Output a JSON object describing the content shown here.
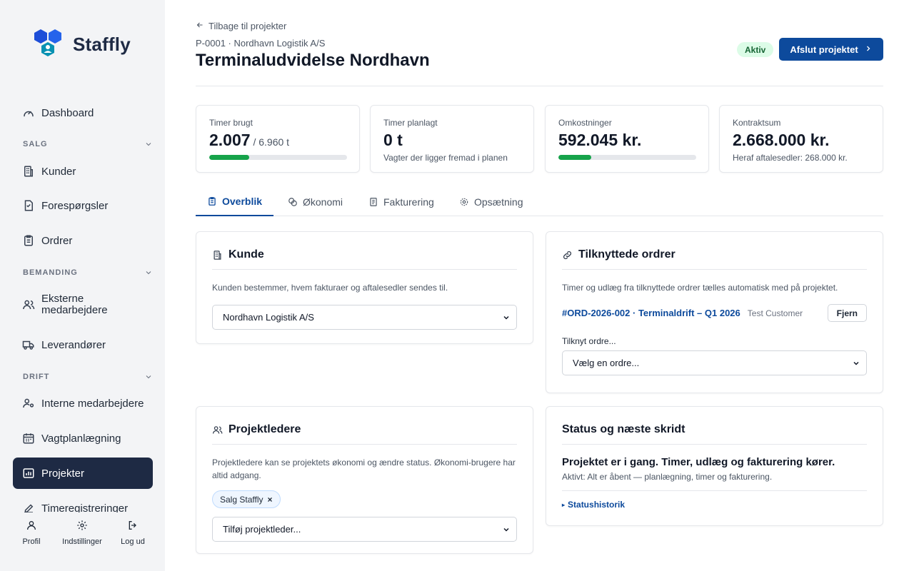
{
  "brand": {
    "name": "Staffly"
  },
  "sidebar": {
    "dashboard": "Dashboard",
    "sections": {
      "salg": "SALG",
      "bemanding": "BEMANDING",
      "drift": "DRIFT"
    },
    "items": {
      "kunder": "Kunder",
      "forespoergsler": "Forespørgsler",
      "ordrer": "Ordrer",
      "eksterne_1": "Eksterne",
      "eksterne_2": "medarbejdere",
      "leverandoerer": "Leverandører",
      "interne": "Interne medarbejdere",
      "vagtplan": "Vagtplanlægning",
      "projekter": "Projekter",
      "timereg": "Timeregistreringer"
    },
    "bottom": {
      "profil": "Profil",
      "indstillinger": "Indstillinger",
      "logud": "Log ud"
    }
  },
  "header": {
    "back": "Tilbage til projekter",
    "subtitle": "P-0001 · Nordhavn Logistik A/S",
    "title": "Terminaludvidelse Nordhavn",
    "status": "Aktiv",
    "primary_action": "Afslut projektet"
  },
  "stats": {
    "timer_brugt": {
      "label": "Timer brugt",
      "value": "2.007",
      "suffix": " / 6.960 t",
      "progress": 0.288
    },
    "timer_planlagt": {
      "label": "Timer planlagt",
      "value": "0 t",
      "sub": "Vagter der ligger fremad i planen"
    },
    "omkostninger": {
      "label": "Omkostninger",
      "value": "592.045 kr.",
      "progress": 0.24
    },
    "kontraktsum": {
      "label": "Kontraktsum",
      "value": "2.668.000 kr.",
      "sub": "Heraf aftalesedler: 268.000 kr."
    }
  },
  "tabs": {
    "overblik": "Overblik",
    "oekonomi": "Økonomi",
    "fakturering": "Fakturering",
    "opsaetning": "Opsætning"
  },
  "kunde": {
    "title": "Kunde",
    "desc": "Kunden bestemmer, hvem fakturaer og aftalesedler sendes til.",
    "selected": "Nordhavn Logistik A/S"
  },
  "ordrer": {
    "title": "Tilknyttede ordrer",
    "desc": "Timer og udlæg fra tilknyttede ordrer tælles automatisk med på projektet.",
    "order_link": "#ORD-2026-002 · Terminaldrift – Q1 2026",
    "order_customer": "Test Customer",
    "remove": "Fjern",
    "attach_label": "Tilknyt ordre...",
    "attach_placeholder": "Vælg en ordre..."
  },
  "projektledere": {
    "title": "Projektledere",
    "desc": "Projektledere kan se projektets økonomi og ændre status. Økonomi-brugere har altid adgang.",
    "chip": "Salg Staffly",
    "chip_remove": "×",
    "add_placeholder": "Tilføj projektleder..."
  },
  "status_card": {
    "title": "Status og næste skridt",
    "headline": "Projektet er i gang. Timer, udlæg og fakturering kører.",
    "sub": "Aktivt: Alt er åbent — planlægning, timer og fakturering.",
    "history": "Statushistorik"
  },
  "colors": {
    "accent": "#0d4a9c",
    "sidebar_active": "#1e2a44",
    "progress": "#16a34a",
    "logo_blue": "#2563eb",
    "logo_teal": "#0891b2"
  }
}
